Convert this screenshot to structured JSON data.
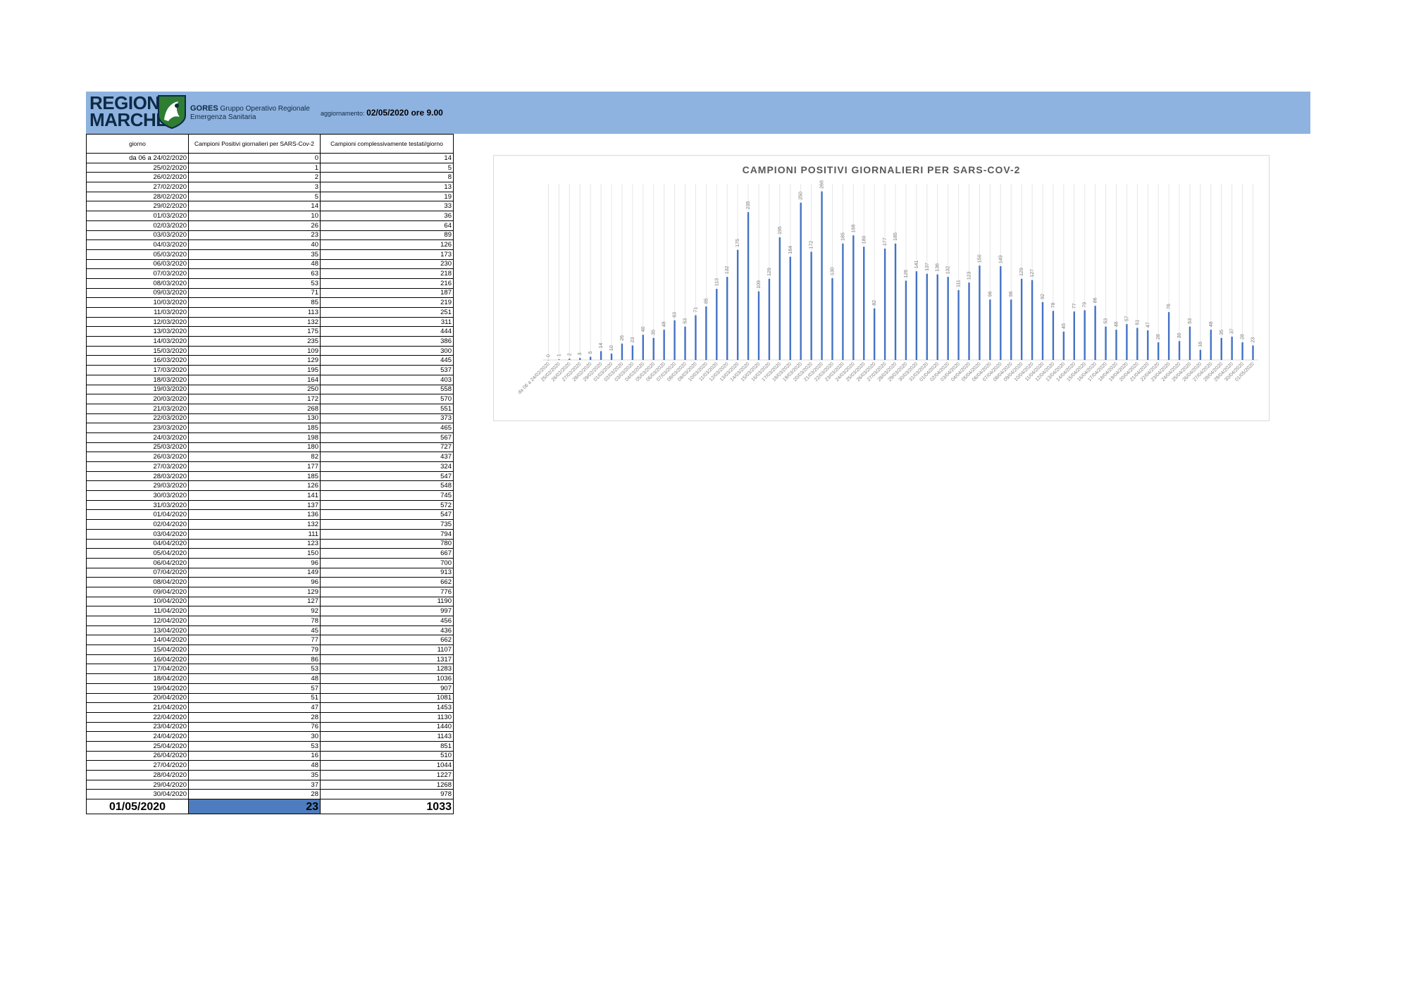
{
  "header": {
    "logo_line1": "REGIONE",
    "logo_line2": "MARCHE",
    "gores_bold": "GORES",
    "gores_line1": "Gruppo Operativo Regionale",
    "gores_line2": "Emergenza Sanitaria",
    "update_label": "aggiornamento:",
    "update_value": "02/05/2020 ore 9.00",
    "accent_color": "#8fb3e0"
  },
  "table": {
    "headers": [
      "giorno",
      "Campioni Positivi giornalieri per SARS-Cov-2",
      "Campioni complessivamente testati/giorno"
    ],
    "rows": [
      [
        "da 06 a 24/02/2020",
        "0",
        "14"
      ],
      [
        "25/02/2020",
        "1",
        "5"
      ],
      [
        "26/02/2020",
        "2",
        "8"
      ],
      [
        "27/02/2020",
        "3",
        "13"
      ],
      [
        "28/02/2020",
        "5",
        "19"
      ],
      [
        "29/02/2020",
        "14",
        "33"
      ],
      [
        "01/03/2020",
        "10",
        "36"
      ],
      [
        "02/03/2020",
        "26",
        "64"
      ],
      [
        "03/03/2020",
        "23",
        "89"
      ],
      [
        "04/03/2020",
        "40",
        "126"
      ],
      [
        "05/03/2020",
        "35",
        "173"
      ],
      [
        "06/03/2020",
        "48",
        "230"
      ],
      [
        "07/03/2020",
        "63",
        "218"
      ],
      [
        "08/03/2020",
        "53",
        "216"
      ],
      [
        "09/03/2020",
        "71",
        "187"
      ],
      [
        "10/03/2020",
        "85",
        "219"
      ],
      [
        "11/03/2020",
        "113",
        "251"
      ],
      [
        "12/03/2020",
        "132",
        "311"
      ],
      [
        "13/03/2020",
        "175",
        "444"
      ],
      [
        "14/03/2020",
        "235",
        "386"
      ],
      [
        "15/03/2020",
        "109",
        "300"
      ],
      [
        "16/03/2020",
        "129",
        "445"
      ],
      [
        "17/03/2020",
        "195",
        "537"
      ],
      [
        "18/03/2020",
        "164",
        "403"
      ],
      [
        "19/03/2020",
        "250",
        "558"
      ],
      [
        "20/03/2020",
        "172",
        "570"
      ],
      [
        "21/03/2020",
        "268",
        "551"
      ],
      [
        "22/03/2020",
        "130",
        "373"
      ],
      [
        "23/03/2020",
        "185",
        "465"
      ],
      [
        "24/03/2020",
        "198",
        "567"
      ],
      [
        "25/03/2020",
        "180",
        "727"
      ],
      [
        "26/03/2020",
        "82",
        "437"
      ],
      [
        "27/03/2020",
        "177",
        "324"
      ],
      [
        "28/03/2020",
        "185",
        "547"
      ],
      [
        "29/03/2020",
        "126",
        "548"
      ],
      [
        "30/03/2020",
        "141",
        "745"
      ],
      [
        "31/03/2020",
        "137",
        "572"
      ],
      [
        "01/04/2020",
        "136",
        "547"
      ],
      [
        "02/04/2020",
        "132",
        "735"
      ],
      [
        "03/04/2020",
        "111",
        "794"
      ],
      [
        "04/04/2020",
        "123",
        "780"
      ],
      [
        "05/04/2020",
        "150",
        "667"
      ],
      [
        "06/04/2020",
        "96",
        "700"
      ],
      [
        "07/04/2020",
        "149",
        "913"
      ],
      [
        "08/04/2020",
        "96",
        "662"
      ],
      [
        "09/04/2020",
        "129",
        "776"
      ],
      [
        "10/04/2020",
        "127",
        "1190"
      ],
      [
        "11/04/2020",
        "92",
        "997"
      ],
      [
        "12/04/2020",
        "78",
        "456"
      ],
      [
        "13/04/2020",
        "45",
        "436"
      ],
      [
        "14/04/2020",
        "77",
        "662"
      ],
      [
        "15/04/2020",
        "79",
        "1107"
      ],
      [
        "16/04/2020",
        "86",
        "1317"
      ],
      [
        "17/04/2020",
        "53",
        "1283"
      ],
      [
        "18/04/2020",
        "48",
        "1036"
      ],
      [
        "19/04/2020",
        "57",
        "907"
      ],
      [
        "20/04/2020",
        "51",
        "1081"
      ],
      [
        "21/04/2020",
        "47",
        "1453"
      ],
      [
        "22/04/2020",
        "28",
        "1130"
      ],
      [
        "23/04/2020",
        "76",
        "1440"
      ],
      [
        "24/04/2020",
        "30",
        "1143"
      ],
      [
        "25/04/2020",
        "53",
        "851"
      ],
      [
        "26/04/2020",
        "16",
        "510"
      ],
      [
        "27/04/2020",
        "48",
        "1044"
      ],
      [
        "28/04/2020",
        "35",
        "1227"
      ],
      [
        "29/04/2020",
        "37",
        "1268"
      ],
      [
        "30/04/2020",
        "28",
        "978"
      ]
    ],
    "total": [
      "01/05/2020",
      "23",
      "1033"
    ],
    "highlight_color": "#4d7dbe"
  },
  "chart_data": {
    "type": "bar",
    "title": "CAMPIONI POSITIVI GIORNALIERI PER SARS-COV-2",
    "categories": [
      "da 06 a 24/02/2020",
      "25/02/2020",
      "26/02/2020",
      "27/02/2020",
      "28/02/2020",
      "29/02/2020",
      "01/03/2020",
      "02/03/2020",
      "03/03/2020",
      "04/03/2020",
      "05/03/2020",
      "06/03/2020",
      "07/03/2020",
      "08/03/2020",
      "09/03/2020",
      "10/03/2020",
      "11/03/2020",
      "12/03/2020",
      "13/03/2020",
      "14/03/2020",
      "15/03/2020",
      "16/03/2020",
      "17/03/2020",
      "18/03/2020",
      "19/03/2020",
      "20/03/2020",
      "21/03/2020",
      "22/03/2020",
      "23/03/2020",
      "24/03/2020",
      "25/03/2020",
      "26/03/2020",
      "27/03/2020",
      "28/03/2020",
      "29/03/2020",
      "30/03/2020",
      "31/03/2020",
      "01/04/2020",
      "02/04/2020",
      "03/04/2020",
      "04/04/2020",
      "05/04/2020",
      "06/04/2020",
      "07/04/2020",
      "08/04/2020",
      "09/04/2020",
      "10/04/2020",
      "11/04/2020",
      "12/04/2020",
      "13/04/2020",
      "14/04/2020",
      "15/04/2020",
      "16/04/2020",
      "17/04/2020",
      "18/04/2020",
      "19/04/2020",
      "20/04/2020",
      "21/04/2020",
      "22/04/2020",
      "23/04/2020",
      "24/04/2020",
      "25/04/2020",
      "26/04/2020",
      "27/04/2020",
      "28/04/2020",
      "29/04/2020",
      "30/04/2020",
      "01/05/2020"
    ],
    "values": [
      0,
      1,
      2,
      3,
      5,
      14,
      10,
      26,
      23,
      40,
      35,
      48,
      63,
      53,
      71,
      85,
      113,
      132,
      175,
      235,
      109,
      129,
      195,
      164,
      250,
      172,
      268,
      130,
      185,
      198,
      180,
      82,
      177,
      185,
      126,
      141,
      137,
      136,
      132,
      111,
      123,
      150,
      96,
      149,
      96,
      129,
      127,
      92,
      78,
      45,
      77,
      79,
      86,
      53,
      48,
      57,
      51,
      47,
      28,
      76,
      30,
      53,
      16,
      48,
      35,
      37,
      28,
      23
    ],
    "ylim": [
      0,
      280
    ],
    "grid": true,
    "legend": "none",
    "bar_color": "#4472c4"
  }
}
